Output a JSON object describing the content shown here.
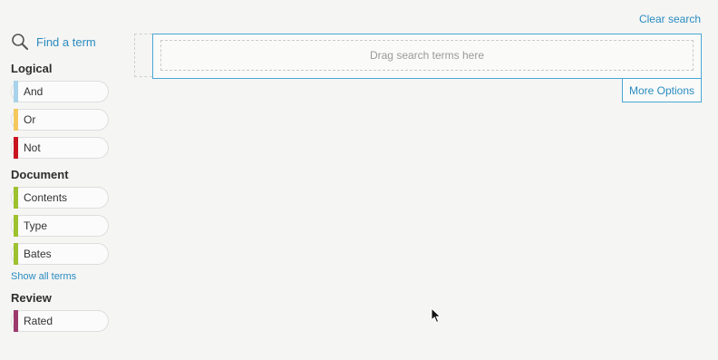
{
  "sidebar": {
    "find_term_label": "Find a term",
    "sections": [
      {
        "title": "Logical",
        "terms": [
          {
            "label": "And",
            "color": "#a8d3ea"
          },
          {
            "label": "Or",
            "color": "#f5c85e"
          },
          {
            "label": "Not",
            "color": "#c8141e"
          }
        ]
      },
      {
        "title": "Document",
        "terms": [
          {
            "label": "Contents",
            "color": "#9ec12f"
          },
          {
            "label": "Type",
            "color": "#9ec12f"
          },
          {
            "label": "Bates",
            "color": "#9ec12f"
          }
        ],
        "show_all_label": "Show all terms"
      },
      {
        "title": "Review",
        "terms": [
          {
            "label": "Rated",
            "color": "#9c3a6e"
          }
        ]
      }
    ]
  },
  "header": {
    "clear_search_label": "Clear search"
  },
  "query": {
    "drop_placeholder": "Drag search terms here",
    "more_options_label": "More Options"
  },
  "colors": {
    "accent": "#2a8cc0",
    "border_accent": "#4aa7d4",
    "background": "#f5f5f4"
  }
}
